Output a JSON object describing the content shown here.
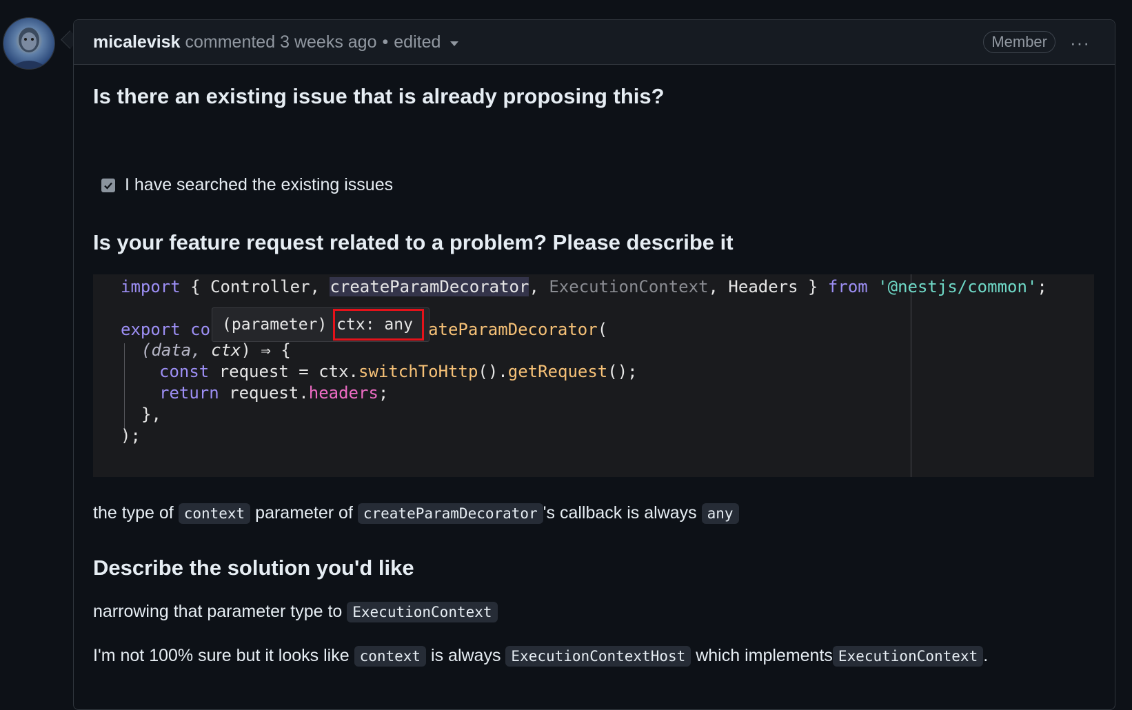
{
  "header": {
    "author": "micalevisk",
    "action": "commented",
    "time": "3 weeks ago",
    "separator": "•",
    "edited": "edited",
    "badge": "Member",
    "menu": "···"
  },
  "sections": {
    "q1_title": "Is there an existing issue that is already proposing this?",
    "checkbox_label": "I have searched the existing issues",
    "q2_title": "Is your feature request related to a problem? Please describe it",
    "q3_title": "Describe the solution you'd like"
  },
  "code": {
    "l1": {
      "import": "import",
      "brace_open": " { ",
      "controller": "Controller, ",
      "createParam": "createParamDecorator",
      "comma": ", ",
      "execCtx": "ExecutionContext",
      "headers": ", Headers } ",
      "from": "from",
      "module": "'@nestjs/common'",
      "semi": ";"
    },
    "l2": {
      "export": "export",
      "co": " co",
      "rest": "ateParamDecorator",
      "paren": "("
    },
    "l3": {
      "open": "(",
      "data": "data",
      "comma": ", ",
      "ctx": "ctx",
      "close": ") ⇒ {"
    },
    "l4": {
      "const": "const",
      "request": " request = ctx.",
      "call1": "switchToHttp",
      "mid": "().",
      "call2": "getRequest",
      "end": "();"
    },
    "l5": {
      "return": "return",
      "request": " request.",
      "headers": "headers",
      "semi": ";"
    },
    "l6": "},",
    "l7": ");",
    "tooltip_prefix": "(parameter) ",
    "tooltip_type": "ctx: any"
  },
  "para1": {
    "t1": "the type of ",
    "c1": "context",
    "t2": " parameter of ",
    "c2": "createParamDecorator",
    "t3": "'s callback is always ",
    "c3": "any"
  },
  "para2": {
    "t1": "narrowing that parameter type to ",
    "c1": "ExecutionContext"
  },
  "para3": {
    "t1": "I'm not 100% sure but it looks like ",
    "c1": "context",
    "t2": " is always ",
    "c2": "ExecutionContextHost",
    "t3": " which implements",
    "c3": "ExecutionContext",
    "t4": "."
  }
}
